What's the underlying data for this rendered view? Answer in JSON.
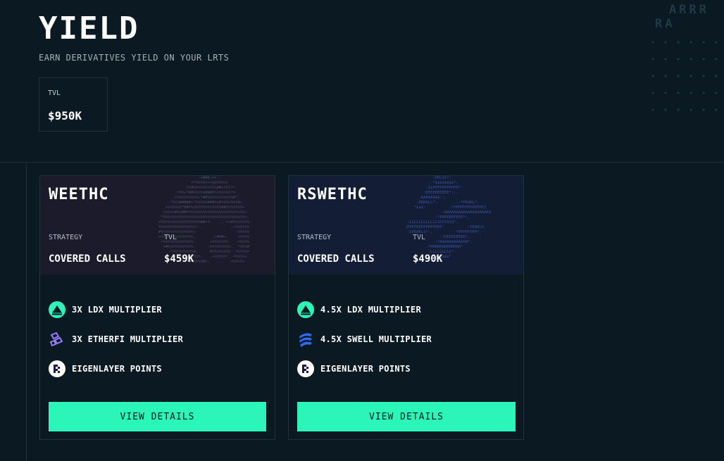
{
  "header": {
    "title": "YIELD",
    "subtitle": "EARN DERIVATIVES YIELD ON YOUR LRTS",
    "tvl_label": "TVL",
    "tvl_value": "$950K"
  },
  "decor": {
    "letters_row1": "ARRR",
    "letters_row2": "RA"
  },
  "colors": {
    "background": "#0b1a22",
    "accent": "#2bf5b8",
    "card_border": "#23333b"
  },
  "cards": [
    {
      "name": "WEETHC",
      "strategy_label": "STRATEGY",
      "strategy_value": "COVERED CALLS",
      "tvl_label": "TVL",
      "tvl_value": "$459K",
      "features": [
        {
          "icon": "ldx-icon",
          "text": "3X LDX MULTIPLIER"
        },
        {
          "icon": "etherfi-icon",
          "text": "3X ETHERFI MULTIPLIER"
        },
        {
          "icon": "eigenlayer-icon",
          "text": "EIGENLAYER POINTS"
        }
      ],
      "button_label": "VIEW DETAILS"
    },
    {
      "name": "RSWETHC",
      "strategy_label": "STRATEGY",
      "strategy_value": "COVERED CALLS",
      "tvl_label": "TVL",
      "tvl_value": "$490K",
      "features": [
        {
          "icon": "ldx-icon",
          "text": "4.5X LDX MULTIPLIER"
        },
        {
          "icon": "swell-icon",
          "text": "4.5X SWELL MULTIPLIER"
        },
        {
          "icon": "eigenlayer-icon",
          "text": "EIGENLAYER POINTS"
        }
      ],
      "button_label": "VIEW DETAILS"
    }
  ]
}
